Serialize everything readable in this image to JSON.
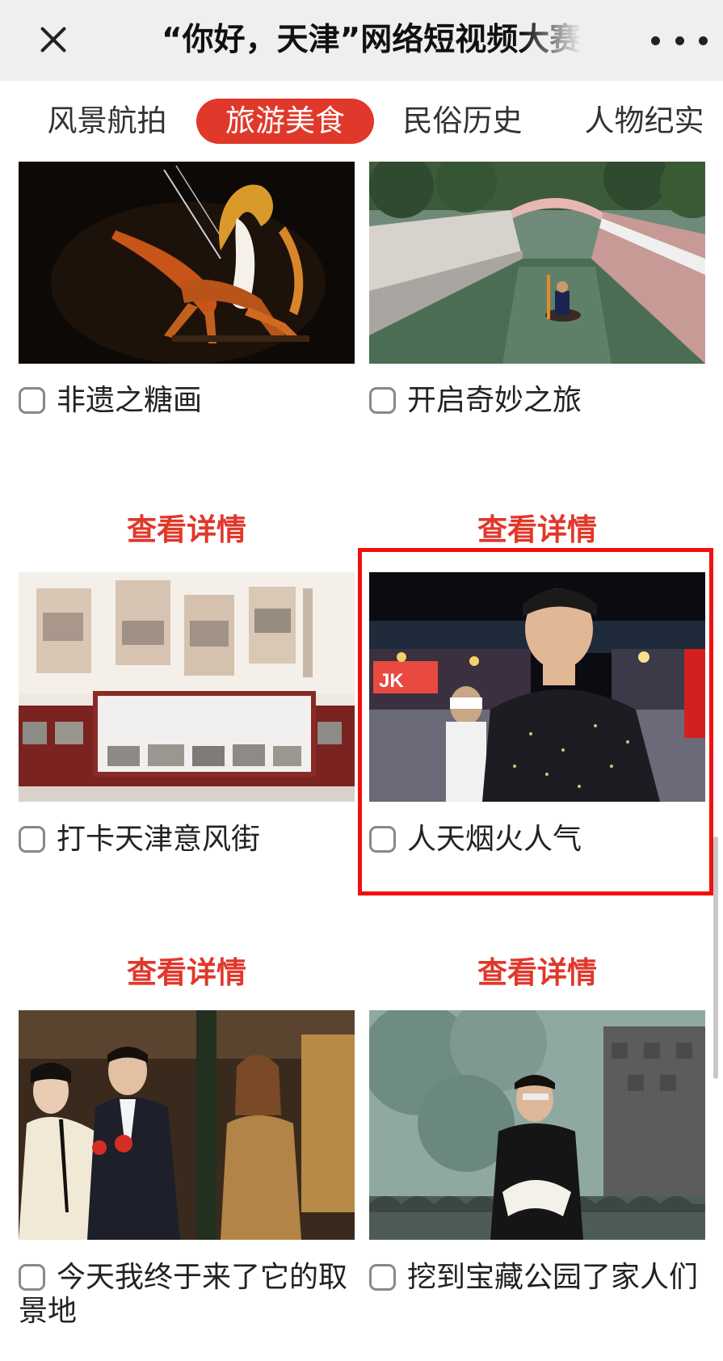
{
  "header": {
    "title": "“你好，天津”网络短视频大赛",
    "close_icon": "close-icon",
    "more_icon": "more-icon"
  },
  "tabs": [
    {
      "label": "风景航拍",
      "active": false
    },
    {
      "label": "旅游美食",
      "active": true
    },
    {
      "label": "民俗历史",
      "active": false
    },
    {
      "label": "人物纪实",
      "active": false
    }
  ],
  "colors": {
    "accent": "#e0382b",
    "header_bg": "#efefef",
    "highlight_border": "#f01010"
  },
  "videos": [
    {
      "title": "非遗之糖画",
      "checked": false
    },
    {
      "title": "开启奇妙之旅",
      "checked": false
    },
    {
      "title": "打卡天津意风街",
      "checked": false
    },
    {
      "title": "人天烟火人气",
      "checked": false,
      "highlighted": true
    },
    {
      "title": "今天我终于来了它的取景地",
      "checked": false
    },
    {
      "title": "挖到宝藏公园了家人们",
      "checked": false
    }
  ],
  "detail_label": "查看详情",
  "thumb_scenes": {
    "sugar_painting_sign": "",
    "night_market_sign": "JK"
  }
}
